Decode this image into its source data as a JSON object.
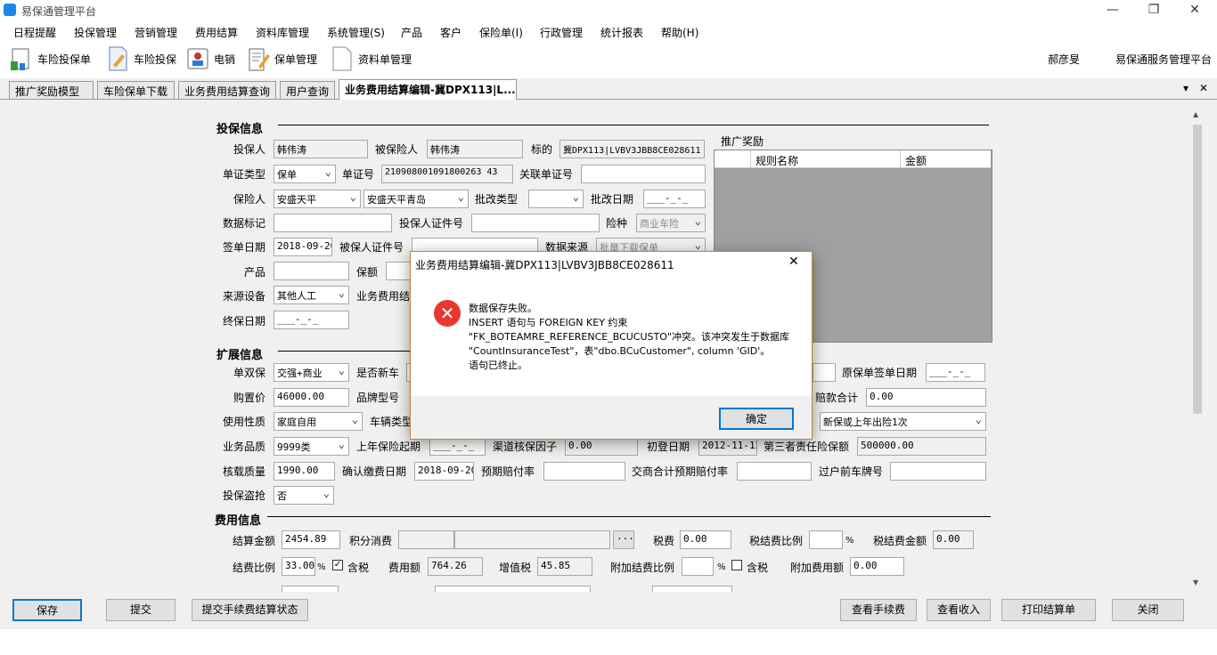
{
  "window": {
    "title": "易保通管理平台",
    "min": "—",
    "restore": "❐",
    "close": "✕"
  },
  "menu": [
    "日程提醒",
    "投保管理",
    "营销管理",
    "费用结算",
    "资料库管理",
    "系统管理(S)",
    "产品",
    "客户",
    "保险单(I)",
    "行政管理",
    "统计报表",
    "帮助(H)"
  ],
  "toolbar": {
    "items": [
      {
        "label": "车险投保单",
        "icon": "vehicle-policy-icon"
      },
      {
        "label": "车险投保",
        "icon": "document-pen-icon"
      },
      {
        "label": "电销",
        "icon": "user-card-icon"
      },
      {
        "label": "保单管理",
        "icon": "policy-edit-icon"
      },
      {
        "label": "资料单管理",
        "icon": "blank-document-icon"
      }
    ],
    "user": "郝彦旻",
    "platform": "易保通服务管理平台"
  },
  "tabs": [
    "推广奖励模型",
    "车险保单下载",
    "业务费用结算查询",
    "用户查询",
    "业务费用结算编辑-冀DPX113|L..."
  ],
  "tab_menu": "▾",
  "tab_close": "✕",
  "sections": {
    "insure": "投保信息",
    "ext": "扩展信息",
    "fee": "费用信息"
  },
  "insure": {
    "applicant_label": "投保人",
    "applicant": "韩伟涛",
    "insured_label": "被保险人",
    "insured": "韩伟涛",
    "target_label": "标的",
    "target": "冀DPX113|LVBV3JBB8CE028611",
    "cert_type_label": "单证类型",
    "cert_type": "保单",
    "cert_no_label": "单证号",
    "cert_no": "210908001091800263 43",
    "rel_cert_label": "关联单证号",
    "rel_cert": "",
    "insurer_label": "保险人",
    "insurer": "安盛天平",
    "insurer_branch": "安盛天平青岛",
    "endorse_type_label": "批改类型",
    "endorse_type": "",
    "endorse_date_label": "批改日期",
    "endorse_date": "___-_-_",
    "data_mark_label": "数据标记",
    "data_mark": "",
    "applicant_id_label": "投保人证件号",
    "applicant_id": "",
    "risk_label": "险种",
    "risk": "商业车险",
    "sign_date_label": "签单日期",
    "sign_date": "2018-09-20",
    "insured_id_label": "被保人证件号",
    "insured_id": "",
    "source_label": "数据来源",
    "source": "批量下载保单",
    "product_label": "产品",
    "product": "",
    "premium_label": "保额",
    "premium": "",
    "device_label": "来源设备",
    "device": "其他人工",
    "bizfee_label": "业务费用结",
    "end_date_label": "终保日期",
    "end_date": "___-_-_"
  },
  "promo": {
    "title": "推广奖励",
    "col_rule": "规则名称",
    "col_amount": "金额"
  },
  "ext": {
    "single_double_label": "单双保",
    "single_double": "交强+商业",
    "new_car_label": "是否新车",
    "orig_sign_label": "原保单签单日期",
    "orig_sign": "___-_-_",
    "price_label": "购置价",
    "price": "46000.00",
    "brand_label": "品牌型号",
    "claims_label": "赔款合计",
    "claims": "0.00",
    "usage_label": "使用性质",
    "usage": "家庭自用",
    "vtype_label": "车辆类型",
    "claim_hist": "新保或上年出险1次",
    "quality_label": "业务品质",
    "quality": "9999类",
    "last_start_label": "上年保险起期",
    "last_start": "___-_-_",
    "channel_factor_label": "渠道核保因子",
    "channel_factor": "0.00",
    "reg_date_label": "初登日期",
    "reg_date": "2012-11-12",
    "third_party_label": "第三者责任险保额",
    "third_party": "500000.00",
    "load_label": "核载质量",
    "load": "1990.00",
    "pay_date_label": "确认缴费日期",
    "pay_date": "2018-09-20",
    "exp_ratio_label": "预期赔付率",
    "exp_ratio": "",
    "cmp_ratio_label": "交商合计预期赔付率",
    "cmp_ratio": "",
    "prev_plate_label": "过户前车牌号",
    "prev_plate": "",
    "theft_label": "投保盗抢",
    "theft": "否"
  },
  "fee": {
    "settle_amt_label": "结算金额",
    "settle_amt": "2454.89",
    "points_label": "积分消费",
    "points_btn": "···",
    "tax_label": "税费",
    "tax": "0.00",
    "tax_ratio_label": "税结费比例",
    "tax_ratio": "",
    "pct": "%",
    "tax_amt_label": "税结费金额",
    "tax_amt": "0.00",
    "ratio_label": "结费比例",
    "ratio": "33.00",
    "ratio_pct": "%",
    "tax_incl_label": "含税",
    "tax_incl": "✓",
    "fee_amt_label": "费用额",
    "fee_amt": "764.26",
    "vat_label": "增值税",
    "vat": "45.85",
    "add_ratio_label": "附加结费比例",
    "add_ratio": "",
    "add_pct": "%",
    "add_tax_label": "含税",
    "add_amt_label": "附加费用额",
    "add_amt": "0.00"
  },
  "buttons": {
    "save": "保存",
    "submit": "提交",
    "submit_state": "提交手续费结算状态",
    "view_fee": "查看手续费",
    "view_income": "查看收入",
    "print": "打印结算单",
    "close": "关闭"
  },
  "dialog": {
    "title": "业务费用结算编辑-冀DPX113|LVBV3JBB8CE028611",
    "close": "✕",
    "lines": [
      "数据保存失败。",
      "INSERT 语句与 FOREIGN KEY 约束",
      "\"FK_BOTEAMRE_REFERENCE_BCUCUSTO\"冲突。该冲突发生于数据库",
      "\"CountInsuranceTest\"，表\"dbo.BCuCustomer\", column 'GID'。",
      "语句已终止。"
    ],
    "ok": "确定"
  },
  "scroll": {
    "up": "▲",
    "down": "▼"
  }
}
